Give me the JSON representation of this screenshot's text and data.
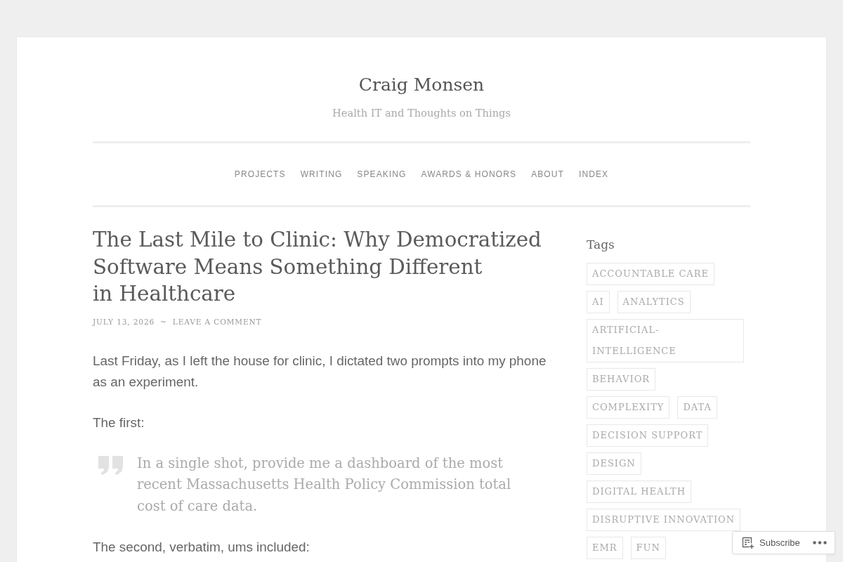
{
  "site": {
    "title": "Craig Monsen",
    "tagline": "Health IT and Thoughts on Things"
  },
  "nav": [
    "PROJECTS",
    "WRITING",
    "SPEAKING",
    "AWARDS & HONORS",
    "ABOUT",
    "INDEX"
  ],
  "post": {
    "title_lines": [
      "The Last Mile to Clinic: Why Democratized",
      "Software Means Something Different",
      "in Healthcare"
    ],
    "date": "JULY 13, 2026",
    "separator": "~",
    "comment_link": "LEAVE A COMMENT",
    "blocks": [
      {
        "kind": "paragraph",
        "text": "Last Friday, as I left the house for clinic, I dictated two prompts into my phone as an experiment."
      },
      {
        "kind": "paragraph",
        "text": "The first:"
      },
      {
        "kind": "quote",
        "text": "In a single shot, provide me a dashboard of the most recent Massachusetts Health Policy Commission total cost of care data."
      },
      {
        "kind": "paragraph",
        "text": "The second, verbatim, ums included:"
      }
    ]
  },
  "sidebar": {
    "widget_title": "Tags",
    "tags": [
      "ACCOUNTABLE CARE",
      "AI",
      "ANALYTICS",
      "ARTIFICIAL-INTELLIGENCE",
      "BEHAVIOR",
      "COMPLEXITY",
      "DATA",
      "DECISION SUPPORT",
      "DESIGN",
      "DIGITAL HEALTH",
      "DISRUPTIVE INNOVATION",
      "EMR",
      "FUN"
    ]
  },
  "subscribe": {
    "label": "Subscribe"
  }
}
